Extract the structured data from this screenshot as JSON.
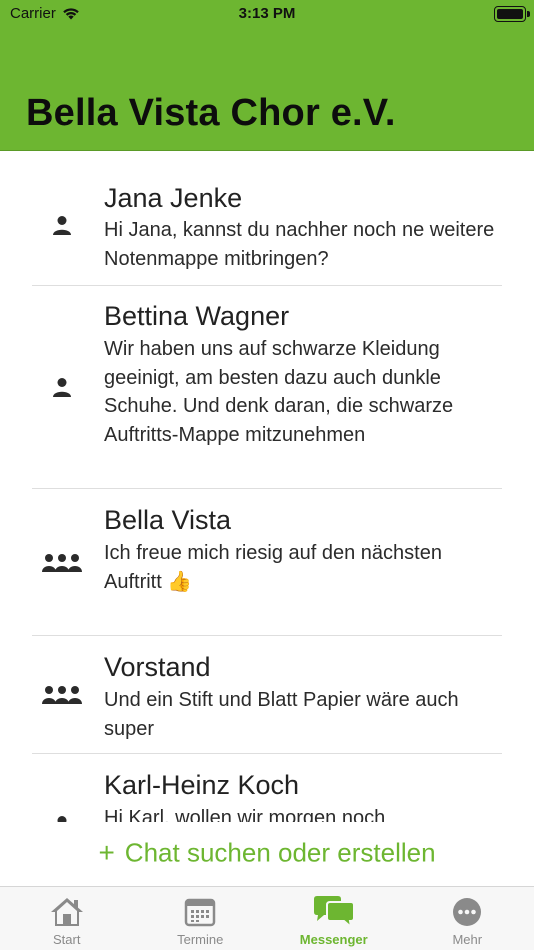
{
  "status_bar": {
    "carrier": "Carrier",
    "time": "3:13 PM"
  },
  "header": {
    "title": "Bella Vista Chor e.V."
  },
  "chats": [
    {
      "name": "Jana Jenke",
      "preview": "Hi Jana, kannst du nachher noch ne weitere Notenmappe mitbringen?",
      "type": "person-icon"
    },
    {
      "name": "Bettina Wagner",
      "preview": "Wir haben uns auf schwarze Kleidung geeinigt, am besten dazu auch dunkle Schuhe. Und denk daran, die schwarze Auftritts-Mappe mitzunehmen",
      "type": "person-icon"
    },
    {
      "name": "Bella Vista",
      "preview": "Ich freue mich riesig auf den nächsten Auftritt 👍",
      "type": "group-icon"
    },
    {
      "name": "Vorstand",
      "preview": "Und ein Stift und Blatt Papier wäre auch super",
      "type": "group-icon"
    },
    {
      "name": "Karl-Heinz Koch",
      "preview": "Hi Karl, wollen wir morgen noch",
      "type": "person-icon"
    }
  ],
  "new_chat": {
    "label": "Chat suchen oder erstellen"
  },
  "tabs": [
    {
      "label": "Start",
      "icon": "home-icon"
    },
    {
      "label": "Termine",
      "icon": "calendar-icon"
    },
    {
      "label": "Messenger",
      "icon": "chat-bubbles-icon",
      "active": true
    },
    {
      "label": "Mehr",
      "icon": "more-icon"
    }
  ],
  "colors": {
    "accent": "#6db631",
    "tab_inactive": "#8a8a8a"
  }
}
